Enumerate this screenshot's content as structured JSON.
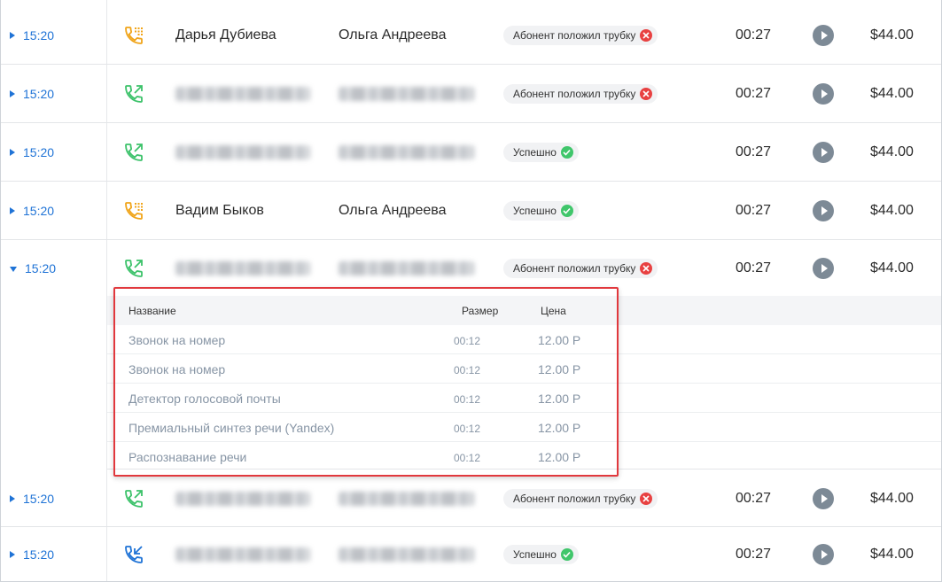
{
  "colors": {
    "accent": "#1f73d6",
    "incoming_orange": "#f0a419",
    "outgoing_green": "#3cc26a",
    "missed_blue": "#1f73d6",
    "error": "#e84141",
    "success": "#40c66b",
    "highlight_border": "#e1383d"
  },
  "rows": [
    {
      "time": "15:20",
      "expanded": false,
      "icon": "phone-incoming-orange-icon",
      "from": "Дарья Дубиева",
      "to": "Ольга Андреева",
      "status": "Абонент положил трубку",
      "status_type": "error",
      "duration": "00:27",
      "price": "$44.00"
    },
    {
      "time": "15:20",
      "expanded": false,
      "icon": "phone-outgoing-green-icon",
      "from": "",
      "to": "",
      "status": "Абонент положил трубку",
      "status_type": "error",
      "duration": "00:27",
      "price": "$44.00"
    },
    {
      "time": "15:20",
      "expanded": false,
      "icon": "phone-outgoing-green-icon",
      "from": "",
      "to": "",
      "status": "Успешно",
      "status_type": "success",
      "duration": "00:27",
      "price": "$44.00"
    },
    {
      "time": "15:20",
      "expanded": false,
      "icon": "phone-incoming-orange-icon",
      "from": "Вадим Быков",
      "to": "Ольга Андреева",
      "status": "Успешно",
      "status_type": "success",
      "duration": "00:27",
      "price": "$44.00"
    },
    {
      "time": "15:20",
      "expanded": true,
      "icon": "phone-outgoing-green-icon",
      "from": "",
      "to": "",
      "status": "Абонент положил трубку",
      "status_type": "error",
      "duration": "00:27",
      "price": "$44.00"
    },
    {
      "time": "15:20",
      "expanded": false,
      "icon": "phone-outgoing-green-icon",
      "from": "",
      "to": "",
      "status": "Абонент положил трубку",
      "status_type": "error",
      "duration": "00:27",
      "price": "$44.00"
    },
    {
      "time": "15:20",
      "expanded": false,
      "icon": "phone-inbound-blue-icon",
      "from": "",
      "to": "",
      "status": "Успешно",
      "status_type": "success",
      "duration": "00:27",
      "price": "$44.00"
    }
  ],
  "details": {
    "headers": {
      "name": "Название",
      "size": "Размер",
      "price": "Цена"
    },
    "items": [
      {
        "name": "Звонок на номер",
        "size": "00:12",
        "price": "12.00 Р"
      },
      {
        "name": "Звонок на номер",
        "size": "00:12",
        "price": "12.00 Р"
      },
      {
        "name": "Детектор голосовой почты",
        "size": "00:12",
        "price": "12.00 Р"
      },
      {
        "name": "Премиальный синтез речи (Yandex)",
        "size": "00:12",
        "price": "12.00 Р"
      },
      {
        "name": "Распознавание речи",
        "size": "00:12",
        "price": "12.00 Р"
      }
    ]
  }
}
